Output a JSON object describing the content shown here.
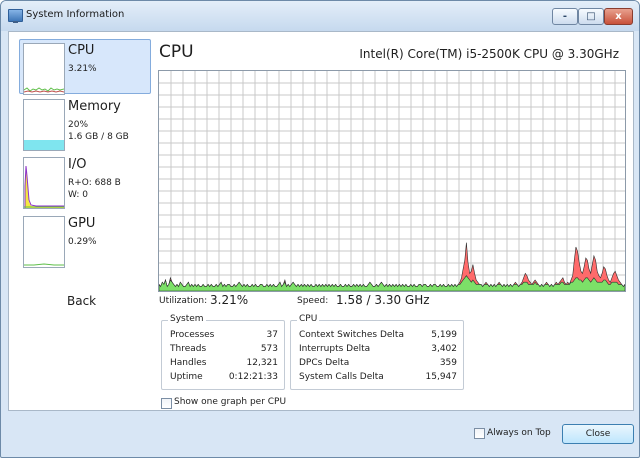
{
  "window": {
    "title": "System Information"
  },
  "title_controls": {
    "minimize": "-",
    "maximize": "□",
    "close": "x"
  },
  "nav": [
    {
      "name": "CPU",
      "line1": "3.21%",
      "line2": "",
      "selected": true
    },
    {
      "name": "Memory",
      "line1": "20%",
      "line2": "1.6 GB / 8 GB",
      "selected": false
    },
    {
      "name": "I/O",
      "line1": "R+O: 688 B",
      "line2": "W: 0",
      "selected": false
    },
    {
      "name": "GPU",
      "line1": "0.29%",
      "line2": "",
      "selected": false
    }
  ],
  "back_label": "Back",
  "graph": {
    "title": "CPU",
    "cpu_model": "Intel(R) Core(TM) i5-2500K CPU @ 3.30GHz",
    "total_series": [
      3,
      2,
      4,
      3,
      5,
      2,
      3,
      6,
      4,
      3,
      2,
      3,
      2,
      4,
      3,
      2,
      2,
      3,
      4,
      2,
      3,
      2,
      3,
      2,
      3,
      2,
      2,
      3,
      2,
      2,
      3,
      2,
      3,
      2,
      2,
      3,
      2,
      3,
      4,
      2,
      3,
      2,
      3,
      3,
      2,
      2,
      3,
      2,
      3,
      4,
      3,
      2,
      3,
      2,
      3,
      2,
      2,
      3,
      2,
      3,
      2,
      2,
      3,
      3,
      2,
      2,
      3,
      2,
      3,
      2,
      3,
      2,
      2,
      3,
      4,
      2,
      3,
      5,
      2,
      3,
      2,
      3,
      4,
      3,
      2,
      3,
      2,
      3,
      2,
      3,
      2,
      3,
      2,
      3,
      2,
      2,
      3,
      2,
      3,
      2,
      3,
      2,
      3,
      2,
      3,
      2,
      3,
      2,
      3,
      2,
      2,
      3,
      2,
      2,
      3,
      2,
      3,
      2,
      2,
      3,
      2,
      3,
      2,
      3,
      2,
      3,
      2,
      2,
      3,
      4,
      3,
      2,
      2,
      3,
      2,
      3,
      4,
      3,
      2,
      3,
      2,
      3,
      2,
      3,
      2,
      3,
      2,
      3,
      2,
      3,
      2,
      3,
      2,
      2,
      3,
      2,
      3,
      2,
      2,
      3,
      3,
      2,
      3,
      3,
      2,
      2,
      3,
      2,
      3,
      3,
      2,
      2,
      3,
      2,
      3,
      2,
      2,
      3,
      2,
      3,
      2,
      3,
      2,
      3,
      4,
      6,
      10,
      14,
      22,
      13,
      8,
      9,
      12,
      8,
      5,
      4,
      3,
      3,
      2,
      3,
      4,
      3,
      2,
      3,
      2,
      3,
      2,
      3,
      4,
      3,
      2,
      3,
      2,
      3,
      2,
      3,
      2,
      3,
      4,
      3,
      2,
      3,
      4,
      6,
      8,
      7,
      5,
      4,
      3,
      4,
      5,
      4,
      3,
      2,
      3,
      2,
      3,
      4,
      3,
      2,
      3,
      2,
      3,
      4,
      3,
      4,
      5,
      6,
      4,
      3,
      4,
      3,
      5,
      7,
      14,
      20,
      18,
      13,
      9,
      8,
      11,
      15,
      14,
      10,
      8,
      12,
      16,
      14,
      9,
      7,
      6,
      8,
      11,
      10,
      7,
      5,
      4,
      6,
      8,
      9,
      7,
      5,
      4,
      3,
      2,
      3
    ],
    "kernel_series": [
      3,
      2,
      4,
      3,
      5,
      2,
      3,
      5,
      4,
      3,
      2,
      3,
      2,
      4,
      3,
      2,
      2,
      3,
      4,
      2,
      3,
      2,
      3,
      2,
      3,
      2,
      2,
      3,
      2,
      2,
      3,
      2,
      3,
      2,
      2,
      3,
      2,
      3,
      4,
      2,
      3,
      2,
      3,
      3,
      2,
      2,
      3,
      2,
      3,
      4,
      3,
      2,
      3,
      2,
      3,
      2,
      2,
      3,
      2,
      3,
      2,
      2,
      3,
      3,
      2,
      2,
      3,
      2,
      3,
      2,
      3,
      2,
      2,
      3,
      4,
      2,
      3,
      4,
      2,
      3,
      2,
      3,
      4,
      3,
      2,
      3,
      2,
      3,
      2,
      3,
      2,
      3,
      2,
      3,
      2,
      2,
      3,
      2,
      3,
      2,
      3,
      2,
      3,
      2,
      3,
      2,
      3,
      2,
      3,
      2,
      2,
      3,
      2,
      2,
      3,
      2,
      3,
      2,
      2,
      3,
      2,
      3,
      2,
      3,
      2,
      3,
      2,
      2,
      3,
      4,
      3,
      2,
      2,
      3,
      2,
      3,
      4,
      3,
      2,
      3,
      2,
      3,
      2,
      3,
      2,
      3,
      2,
      3,
      2,
      3,
      2,
      3,
      2,
      2,
      3,
      2,
      3,
      2,
      2,
      3,
      3,
      2,
      3,
      3,
      2,
      2,
      3,
      2,
      3,
      3,
      2,
      2,
      3,
      2,
      3,
      2,
      2,
      3,
      2,
      3,
      2,
      3,
      2,
      3,
      3,
      4,
      5,
      6,
      7,
      6,
      5,
      4,
      5,
      4,
      3,
      3,
      3,
      3,
      2,
      3,
      3,
      3,
      2,
      3,
      2,
      3,
      2,
      3,
      3,
      3,
      2,
      3,
      2,
      3,
      2,
      3,
      2,
      3,
      3,
      3,
      2,
      3,
      3,
      4,
      4,
      4,
      3,
      3,
      3,
      3,
      4,
      3,
      3,
      2,
      3,
      2,
      3,
      3,
      3,
      2,
      3,
      2,
      3,
      3,
      3,
      3,
      4,
      4,
      3,
      3,
      3,
      3,
      4,
      4,
      5,
      6,
      6,
      5,
      5,
      4,
      5,
      6,
      6,
      5,
      4,
      5,
      6,
      5,
      4,
      4,
      4,
      4,
      5,
      5,
      4,
      3,
      3,
      4,
      4,
      4,
      4,
      3,
      3,
      3,
      2,
      3
    ]
  },
  "stats": {
    "utilization_label": "Utilization:",
    "utilization_value": "3.21%",
    "speed_label": "Speed:",
    "speed_value": "1.58 / 3.30 GHz"
  },
  "system_group": {
    "title": "System",
    "rows": [
      {
        "label": "Processes",
        "value": "37"
      },
      {
        "label": "Threads",
        "value": "573"
      },
      {
        "label": "Handles",
        "value": "12,321"
      },
      {
        "label": "Uptime",
        "value": "0:12:21:33"
      }
    ]
  },
  "cpu_group": {
    "title": "CPU",
    "rows": [
      {
        "label": "Context Switches Delta",
        "value": "5,199"
      },
      {
        "label": "Interrupts Delta",
        "value": "3,402"
      },
      {
        "label": "DPCs Delta",
        "value": "359"
      },
      {
        "label": "System Calls Delta",
        "value": "15,947"
      }
    ]
  },
  "show_one_graph": {
    "label": "Show one graph per CPU",
    "checked": false
  },
  "always_on_top": {
    "label": "Always on Top",
    "checked": false
  },
  "close_label": "Close",
  "colors": {
    "total_fill": "#ff6b6b",
    "kernel_fill": "#7ce068",
    "grid": "#c9c9c9",
    "memory_fill": "#7fe5ef",
    "io_line": "#8d32c8"
  }
}
